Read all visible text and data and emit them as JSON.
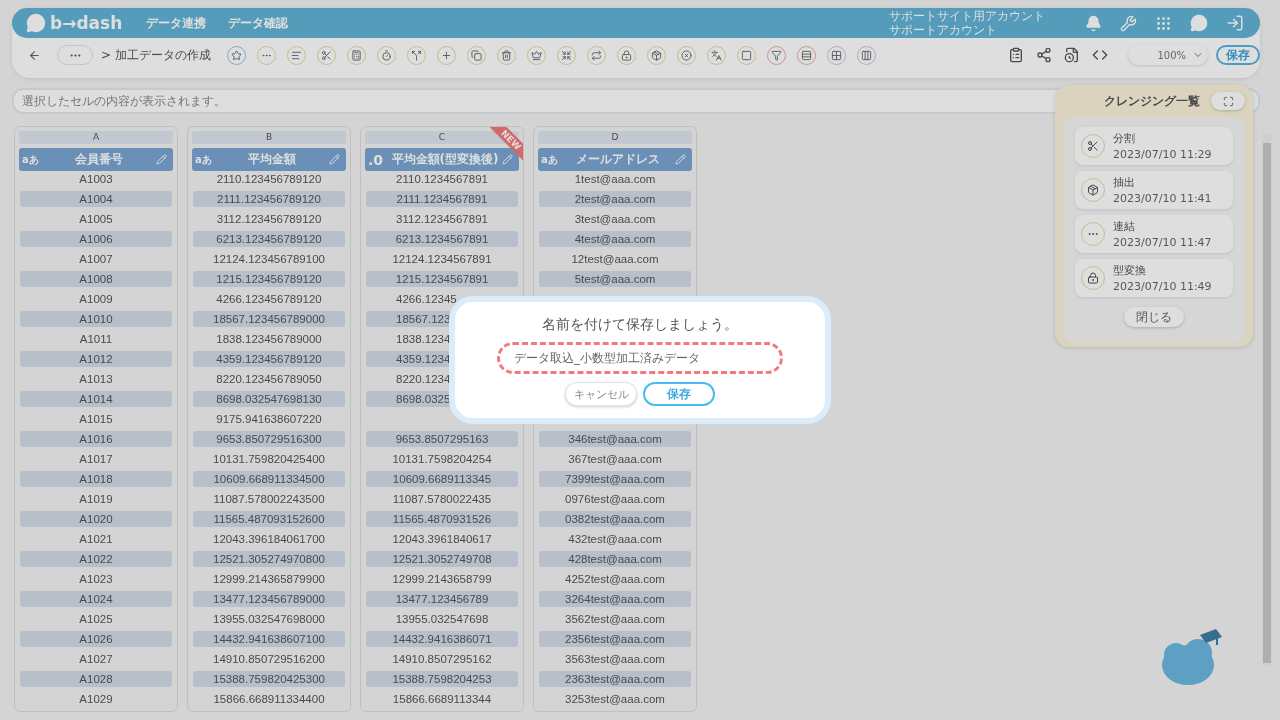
{
  "header": {
    "logo": "b→dash",
    "nav": [
      "データ連携",
      "データ確認"
    ],
    "account": [
      "サポートサイト用アカウント",
      "サポートアカウント"
    ]
  },
  "toolbar": {
    "breadcrumb": "> 加工データの作成",
    "zoom": "100%",
    "save": "保存"
  },
  "formula_bar": {
    "placeholder": "選択したセルの内容が表示されます。"
  },
  "columns": [
    {
      "letter": "A",
      "type": "aあ",
      "name": "会員番号"
    },
    {
      "letter": "B",
      "type": "aあ",
      "name": "平均金額"
    },
    {
      "letter": "C",
      "type": ".0",
      "name": "平均金額(型変換後)",
      "badge": "NEW"
    },
    {
      "letter": "D",
      "type": "aあ",
      "name": "メールアドレス"
    }
  ],
  "rows": [
    {
      "cells": [
        "A1003",
        "2110.123456789120",
        "2110.1234567891",
        "1test@aaa.com"
      ]
    },
    {
      "cells": [
        "A1004",
        "2111.123456789120",
        "2111.1234567891",
        "2test@aaa.com"
      ]
    },
    {
      "cells": [
        "A1005",
        "3112.123456789120",
        "3112.1234567891",
        "3test@aaa.com"
      ]
    },
    {
      "cells": [
        "A1006",
        "6213.123456789120",
        "6213.1234567891",
        "4test@aaa.com"
      ]
    },
    {
      "cells": [
        "A1007",
        "12124.123456789100",
        "12124.1234567891",
        "12test@aaa.com"
      ]
    },
    {
      "cells": [
        "A1008",
        "1215.123456789120",
        "1215.1234567891",
        "5test@aaa.com"
      ]
    },
    {
      "cells": [
        "A1009",
        "4266.123456789120",
        "4266.12345"
      ]
    },
    {
      "cells": [
        "A1010",
        "18567.123456789000",
        "18567.123"
      ]
    },
    {
      "cells": [
        "A1011",
        "1838.123456789000",
        "1838.1234"
      ]
    },
    {
      "cells": [
        "A1012",
        "4359.123456789120",
        "4359.1234"
      ]
    },
    {
      "cells": [
        "A1013",
        "8220.123456789050",
        "8220.1234"
      ]
    },
    {
      "cells": [
        "A1014",
        "8698.032547698130",
        "8698.0325"
      ]
    },
    {
      "cells": [
        "A1015",
        "9175.941638607220"
      ]
    },
    {
      "cells": [
        "A1016",
        "9653.850729516300",
        "9653.8507295163",
        "346test@aaa.com"
      ]
    },
    {
      "cells": [
        "A1017",
        "10131.759820425400",
        "10131.7598204254",
        "367test@aaa.com"
      ]
    },
    {
      "cells": [
        "A1018",
        "10609.668911334500",
        "10609.6689113345",
        "7399test@aaa.com"
      ]
    },
    {
      "cells": [
        "A1019",
        "11087.578002243500",
        "11087.5780022435",
        "0976test@aaa.com"
      ]
    },
    {
      "cells": [
        "A1020",
        "11565.487093152600",
        "11565.4870931526",
        "0382test@aaa.com"
      ]
    },
    {
      "cells": [
        "A1021",
        "12043.396184061700",
        "12043.3961840617",
        "432test@aaa.com"
      ]
    },
    {
      "cells": [
        "A1022",
        "12521.305274970800",
        "12521.3052749708",
        "428test@aaa.com"
      ]
    },
    {
      "cells": [
        "A1023",
        "12999.214365879900",
        "12999.2143658799",
        "4252test@aaa.com"
      ]
    },
    {
      "cells": [
        "A1024",
        "13477.123456789000",
        "13477.123456789",
        "3264test@aaa.com"
      ]
    },
    {
      "cells": [
        "A1025",
        "13955.032547698000",
        "13955.032547698",
        "3562test@aaa.com"
      ]
    },
    {
      "cells": [
        "A1026",
        "14432.941638607100",
        "14432.9416386071",
        "2356test@aaa.com"
      ]
    },
    {
      "cells": [
        "A1027",
        "14910.850729516200",
        "14910.8507295162",
        "3563test@aaa.com"
      ]
    },
    {
      "cells": [
        "A1028",
        "15388.759820425300",
        "15388.7598204253",
        "2363test@aaa.com"
      ]
    },
    {
      "cells": [
        "A1029",
        "15866.668911334400",
        "15866.6689113344",
        "3253test@aaa.com"
      ]
    }
  ],
  "cleansing_panel": {
    "title": "クレンジング一覧",
    "items": [
      {
        "kind": "split",
        "name": "分割",
        "time": "2023/07/10 11:29"
      },
      {
        "kind": "extract",
        "name": "抽出",
        "time": "2023/07/10 11:41"
      },
      {
        "kind": "join",
        "name": "連結",
        "time": "2023/07/10 11:47"
      },
      {
        "kind": "convert",
        "name": "型変換",
        "time": "2023/07/10 11:49"
      }
    ],
    "close": "閉じる"
  },
  "dialog": {
    "title": "名前を付けて保存しましょう。",
    "value": "データ取込_小数型加工済みデータ",
    "cancel": "キャンセル",
    "save": "保存"
  }
}
